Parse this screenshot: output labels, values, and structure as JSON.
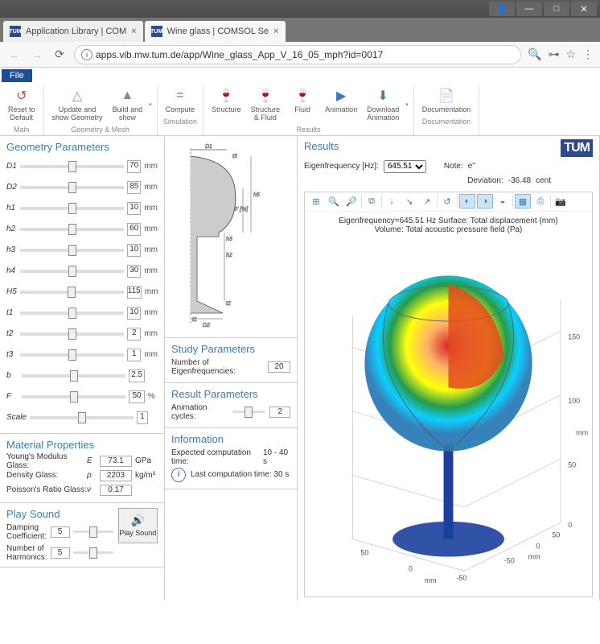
{
  "browser": {
    "tabs": [
      {
        "title": "Application Library | COM",
        "active": false
      },
      {
        "title": "Wine glass | COMSOL Se",
        "active": true
      }
    ],
    "url": "apps.vib.mw.tum.de/app/Wine_glass_App_V_16_05_mph?id=0017"
  },
  "menu": {
    "file": "File"
  },
  "ribbon": {
    "groups": [
      {
        "label": "Main",
        "items": [
          {
            "icon": "↺",
            "color": "#c0504d",
            "label": "Reset to\nDefault"
          }
        ]
      },
      {
        "label": "Geometry & Mesh",
        "dropdown": true,
        "items": [
          {
            "icon": "△",
            "color": "#d98b3d",
            "label": "Update and\nshow Geometry"
          },
          {
            "icon": "▲",
            "color": "#888",
            "label": "Build and\nshow"
          }
        ]
      },
      {
        "label": "Simulation",
        "items": [
          {
            "icon": "=",
            "color": "#4a7db3",
            "label": "Compute"
          }
        ]
      },
      {
        "label": "Results",
        "dropdown": true,
        "items": [
          {
            "icon": "🍷",
            "color": "#2b8a3e",
            "label": "Structure"
          },
          {
            "icon": "🍷",
            "color": "#3b7cb5",
            "label": "Structure\n& Fluid"
          },
          {
            "icon": "🍷",
            "color": "#3b7cb5",
            "label": "Fluid"
          },
          {
            "icon": "▶",
            "color": "#3b7cb5",
            "label": "Animation"
          },
          {
            "icon": "⬇",
            "color": "#3b7cb5",
            "label": "Download\nAnimation"
          }
        ]
      },
      {
        "label": "Documentation",
        "items": [
          {
            "icon": "📄",
            "color": "#3b7cb5",
            "label": "Documentation"
          }
        ]
      }
    ]
  },
  "geometry": {
    "title": "Geometry Parameters",
    "params": [
      {
        "label": "D1",
        "value": "70",
        "unit": "mm"
      },
      {
        "label": "D2",
        "value": "85",
        "unit": "mm"
      },
      {
        "label": "h1",
        "value": "10",
        "unit": "mm"
      },
      {
        "label": "h2",
        "value": "60",
        "unit": "mm"
      },
      {
        "label": "h3",
        "value": "10",
        "unit": "mm"
      },
      {
        "label": "h4",
        "value": "30",
        "unit": "mm"
      },
      {
        "label": "H5",
        "value": "115",
        "unit": "mm"
      },
      {
        "label": "t1",
        "value": "10",
        "unit": "mm"
      },
      {
        "label": "t2",
        "value": "2",
        "unit": "mm"
      },
      {
        "label": "t3",
        "value": "1",
        "unit": "mm"
      },
      {
        "label": "b",
        "value": "2.5",
        "unit": ""
      },
      {
        "label": "F",
        "value": "50",
        "unit": "%"
      },
      {
        "label": "Scale",
        "value": "1",
        "unit": ""
      }
    ]
  },
  "material": {
    "title": "Material Properties",
    "rows": [
      {
        "label": "Young's Modulus Glass:",
        "sym": "E",
        "value": "73.1",
        "unit": "GPa"
      },
      {
        "label": "Density Glass:",
        "sym": "ρ",
        "value": "2203",
        "unit": "kg/m³"
      },
      {
        "label": "Poisson's Ratio Glass:",
        "sym": "ν",
        "value": "0.17",
        "unit": ""
      }
    ]
  },
  "play": {
    "title": "Play Sound",
    "button": "Play Sound",
    "damping_label": "Damping Coefficient:",
    "damping_value": "5",
    "harmonics_label": "Number of Harmonics:",
    "harmonics_value": "5"
  },
  "study": {
    "title": "Study Parameters",
    "eigen_label": "Number of Eigenfrequencies:",
    "eigen_value": "20"
  },
  "result_params": {
    "title": "Result Parameters",
    "anim_label": "Animation cycles:",
    "anim_value": "2"
  },
  "information": {
    "title": "Information",
    "expected_label": "Expected computation time:",
    "expected_value": "10 - 40 s",
    "last_label": "Last computation time: 30 s"
  },
  "results": {
    "title": "Results",
    "logo": "TUM",
    "eigen_label": "Eigenfrequency [Hz]:",
    "eigen_value": "645.51",
    "note_label": "Note:",
    "note_value": "e''",
    "deviation_label": "Deviation:",
    "deviation_value": "-36.48",
    "deviation_unit": "cent",
    "plot_caption1": "Eigenfrequency=645.51 Hz   Surface: Total displacement (mm)",
    "plot_caption2": "Volume: Total acoustic pressure field (Pa)",
    "axis_ticks": [
      "-50",
      "0",
      "50",
      "100",
      "150"
    ],
    "axis_unit": "mm"
  }
}
